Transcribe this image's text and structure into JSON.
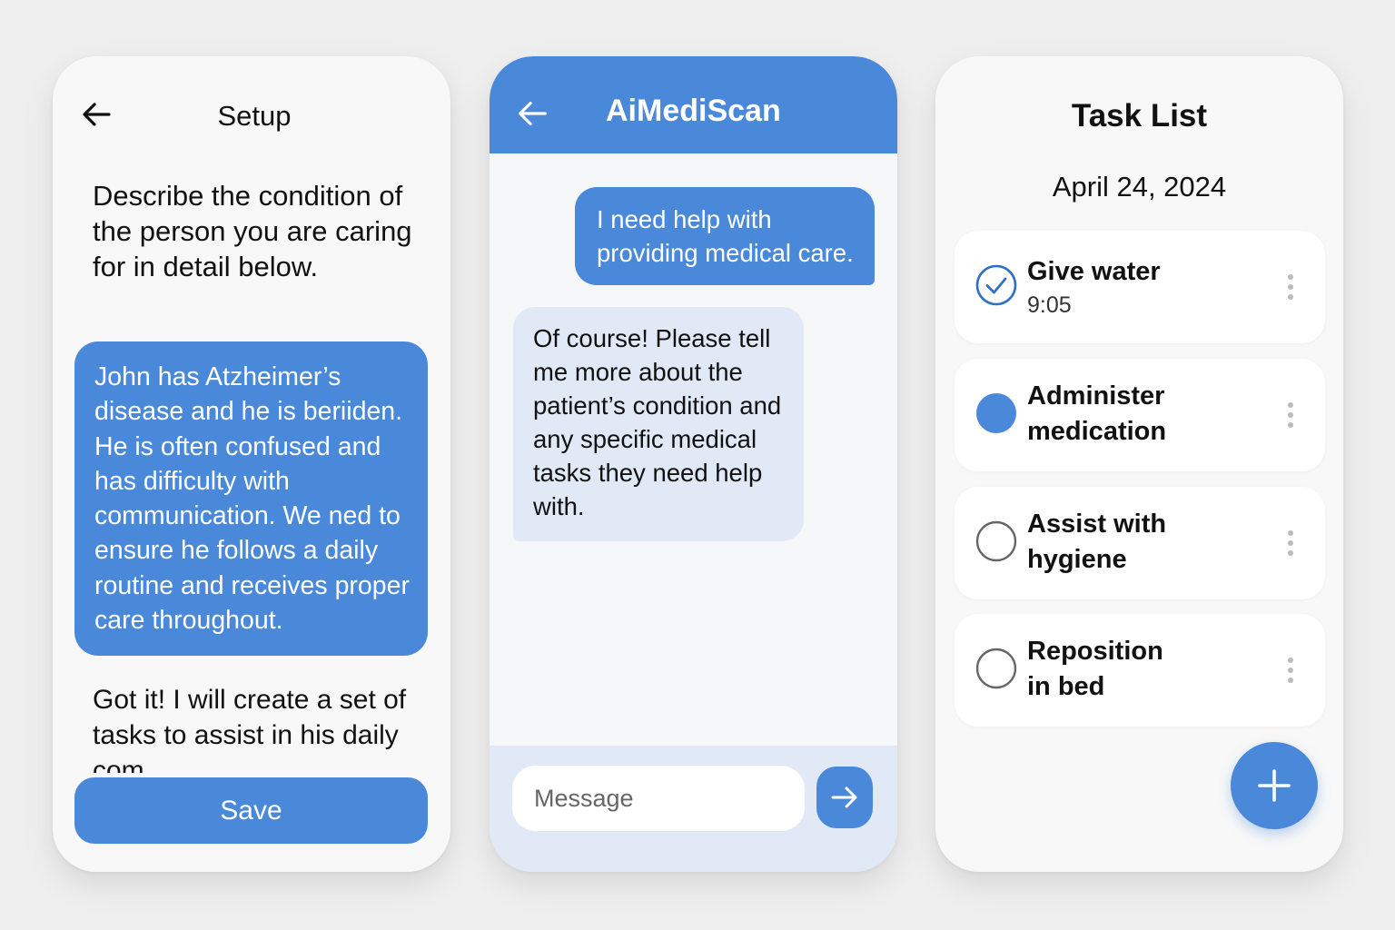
{
  "colors": {
    "accent": "#4a89d9",
    "bubble_light": "#e1e9f7",
    "background": "#efefef",
    "panel": "#f8f8f8"
  },
  "setup": {
    "back_icon": "back-arrow-icon",
    "title": "Setup",
    "prompt": "Describe the condition of the person you are caring for in detail below.",
    "description": "John has Atzheimer’s disease and he is beriiden. He is often confused and has difficulty with communication. We ned to ensure he follows a daily routine and receives proper care throughout.",
    "reply": "Got it! I will create a set of tasks to assist in his daily com",
    "save_label": "Save"
  },
  "chat": {
    "back_icon": "back-arrow-icon",
    "title": "AiMediScan",
    "messages": [
      {
        "from": "user",
        "text": "I need help with providing medical care."
      },
      {
        "from": "bot",
        "text": "Of course! Please tell me more about the patient’s condition and any specific medical tasks they need help with."
      }
    ],
    "input_placeholder": "Message",
    "send_icon": "arrow-right-icon"
  },
  "tasks": {
    "title": "Task List",
    "date": "April 24, 2024",
    "items": [
      {
        "label": "Give water",
        "time": "9:05",
        "status": "done"
      },
      {
        "label": "Administer medication",
        "status": "active"
      },
      {
        "label": "Assist with hygiene",
        "status": "pending"
      },
      {
        "label": "Reposition in bed",
        "status": "pending"
      }
    ],
    "add_icon": "plus-icon"
  }
}
